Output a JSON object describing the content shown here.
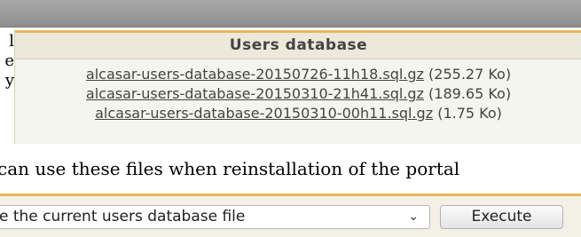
{
  "left_fragments": [
    "l",
    "e",
    "y"
  ],
  "users_database": {
    "title": "Users database",
    "files": [
      {
        "filename": "alcasar-users-database-20150726-11h18.sql.gz",
        "size": "(255.27 Ko)"
      },
      {
        "filename": "alcasar-users-database-20150310-21h41.sql.gz",
        "size": "(189.65 Ko)"
      },
      {
        "filename": "alcasar-users-database-20150310-00h11.sql.gz",
        "size": "(1.75 Ko)"
      }
    ]
  },
  "info_text": "can use these files when reinstallation of the portal",
  "action": {
    "selected_option": "e the current users database file",
    "execute_label": "Execute"
  }
}
